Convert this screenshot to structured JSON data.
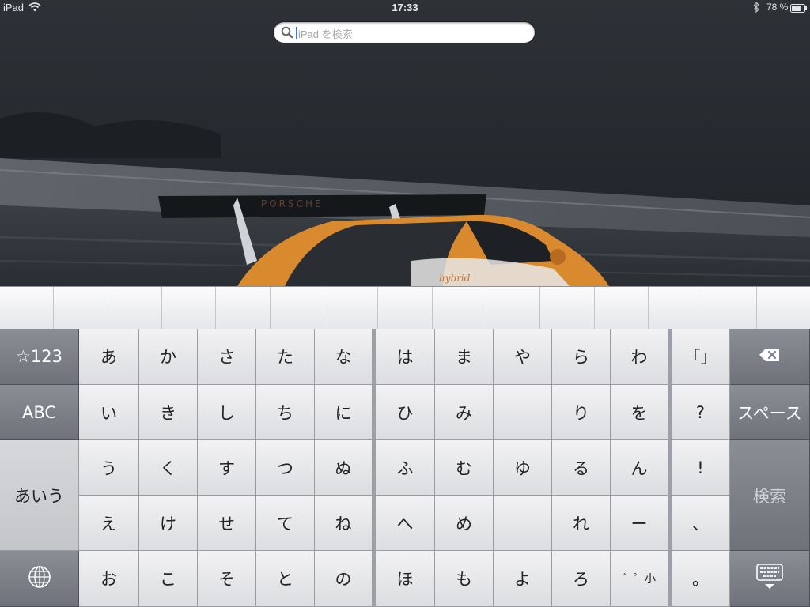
{
  "status_bar": {
    "device": "iPad",
    "time": "17:33",
    "battery_text": "78 %",
    "battery_level": 0.78
  },
  "search": {
    "placeholder": "iPad を検索"
  },
  "wallpaper": {
    "car_text": "PORSCHE",
    "car_script": "hybrid"
  },
  "candidate_bar": {
    "cells": 15
  },
  "keyboard": {
    "left_column": {
      "numbers": "☆123",
      "abc": "ABC",
      "kana": "あいう",
      "globe_icon": "globe-icon"
    },
    "kana_columns": [
      [
        "あ",
        "い",
        "う",
        "え",
        "お"
      ],
      [
        "か",
        "き",
        "く",
        "け",
        "こ"
      ],
      [
        "さ",
        "し",
        "す",
        "せ",
        "そ"
      ],
      [
        "た",
        "ち",
        "つ",
        "て",
        "と"
      ],
      [
        "な",
        "に",
        "ぬ",
        "ね",
        "の"
      ],
      [
        "は",
        "ひ",
        "ふ",
        "へ",
        "ほ"
      ],
      [
        "ま",
        "み",
        "む",
        "め",
        "も"
      ],
      [
        "や",
        "",
        "ゆ",
        "",
        "よ"
      ],
      [
        "ら",
        "り",
        "る",
        "れ",
        "ろ"
      ],
      [
        "わ",
        "を",
        "ん",
        "ー",
        "゛゜小"
      ]
    ],
    "punct_column": [
      "「」",
      "?",
      "!",
      "、",
      "。"
    ],
    "right_column": {
      "delete_icon": "backspace-icon",
      "space": "スペース",
      "search": "検索",
      "dismiss_icon": "keyboard-dismiss-icon"
    }
  },
  "colors": {
    "key_light": "#e9e9eb",
    "key_dark": "#7b7e86",
    "search_cursor": "#3a78d8"
  }
}
